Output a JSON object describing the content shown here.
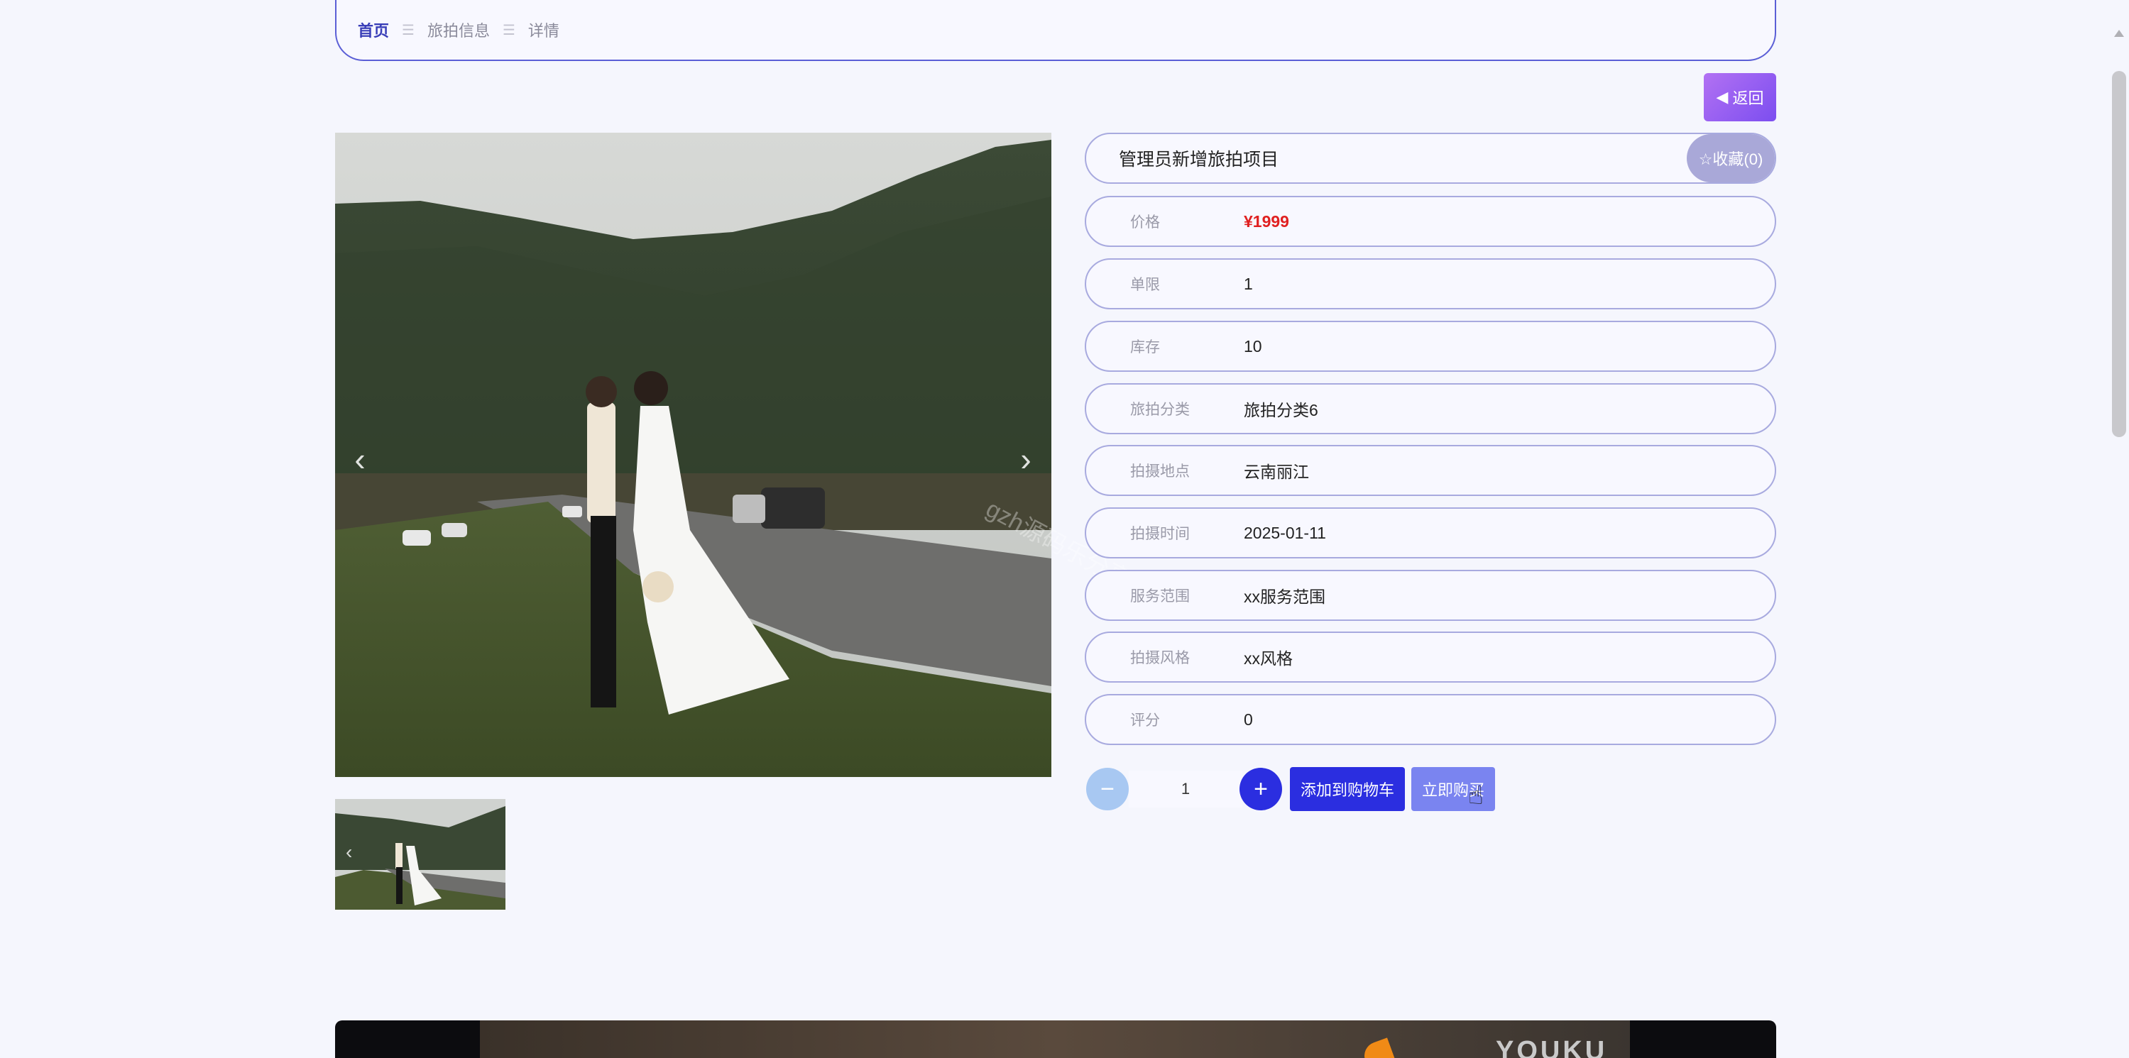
{
  "breadcrumb": {
    "items": [
      "首页",
      "旅拍信息",
      "详情"
    ],
    "separator": "☰"
  },
  "back_button": {
    "label": "返回"
  },
  "gallery": {
    "prev_icon": "chevron-left-icon",
    "next_icon": "chevron-right-icon",
    "watermark": "gzh源码乐分享"
  },
  "product": {
    "title": "管理员新增旅拍项目",
    "favorite_label": "☆收藏(0)",
    "fields": [
      {
        "label": "价格",
        "value": "¥1999",
        "type": "price"
      },
      {
        "label": "单限",
        "value": "1"
      },
      {
        "label": "库存",
        "value": "10"
      },
      {
        "label": "旅拍分类",
        "value": "旅拍分类6"
      },
      {
        "label": "拍摄地点",
        "value": "云南丽江"
      },
      {
        "label": "拍摄时间",
        "value": "2025-01-11"
      },
      {
        "label": "服务范围",
        "value": "xx服务范围"
      },
      {
        "label": "拍摄风格",
        "value": "xx风格"
      },
      {
        "label": "评分",
        "value": "0"
      }
    ]
  },
  "actions": {
    "minus_label": "−",
    "quantity": "1",
    "plus_label": "+",
    "add_to_cart": "添加到购物车",
    "buy_now": "立即购买"
  },
  "video": {
    "brand": "YOUKU"
  },
  "colors": {
    "accent": "#2b2ee0",
    "price": "#e02020",
    "border": "#a8aadf"
  }
}
